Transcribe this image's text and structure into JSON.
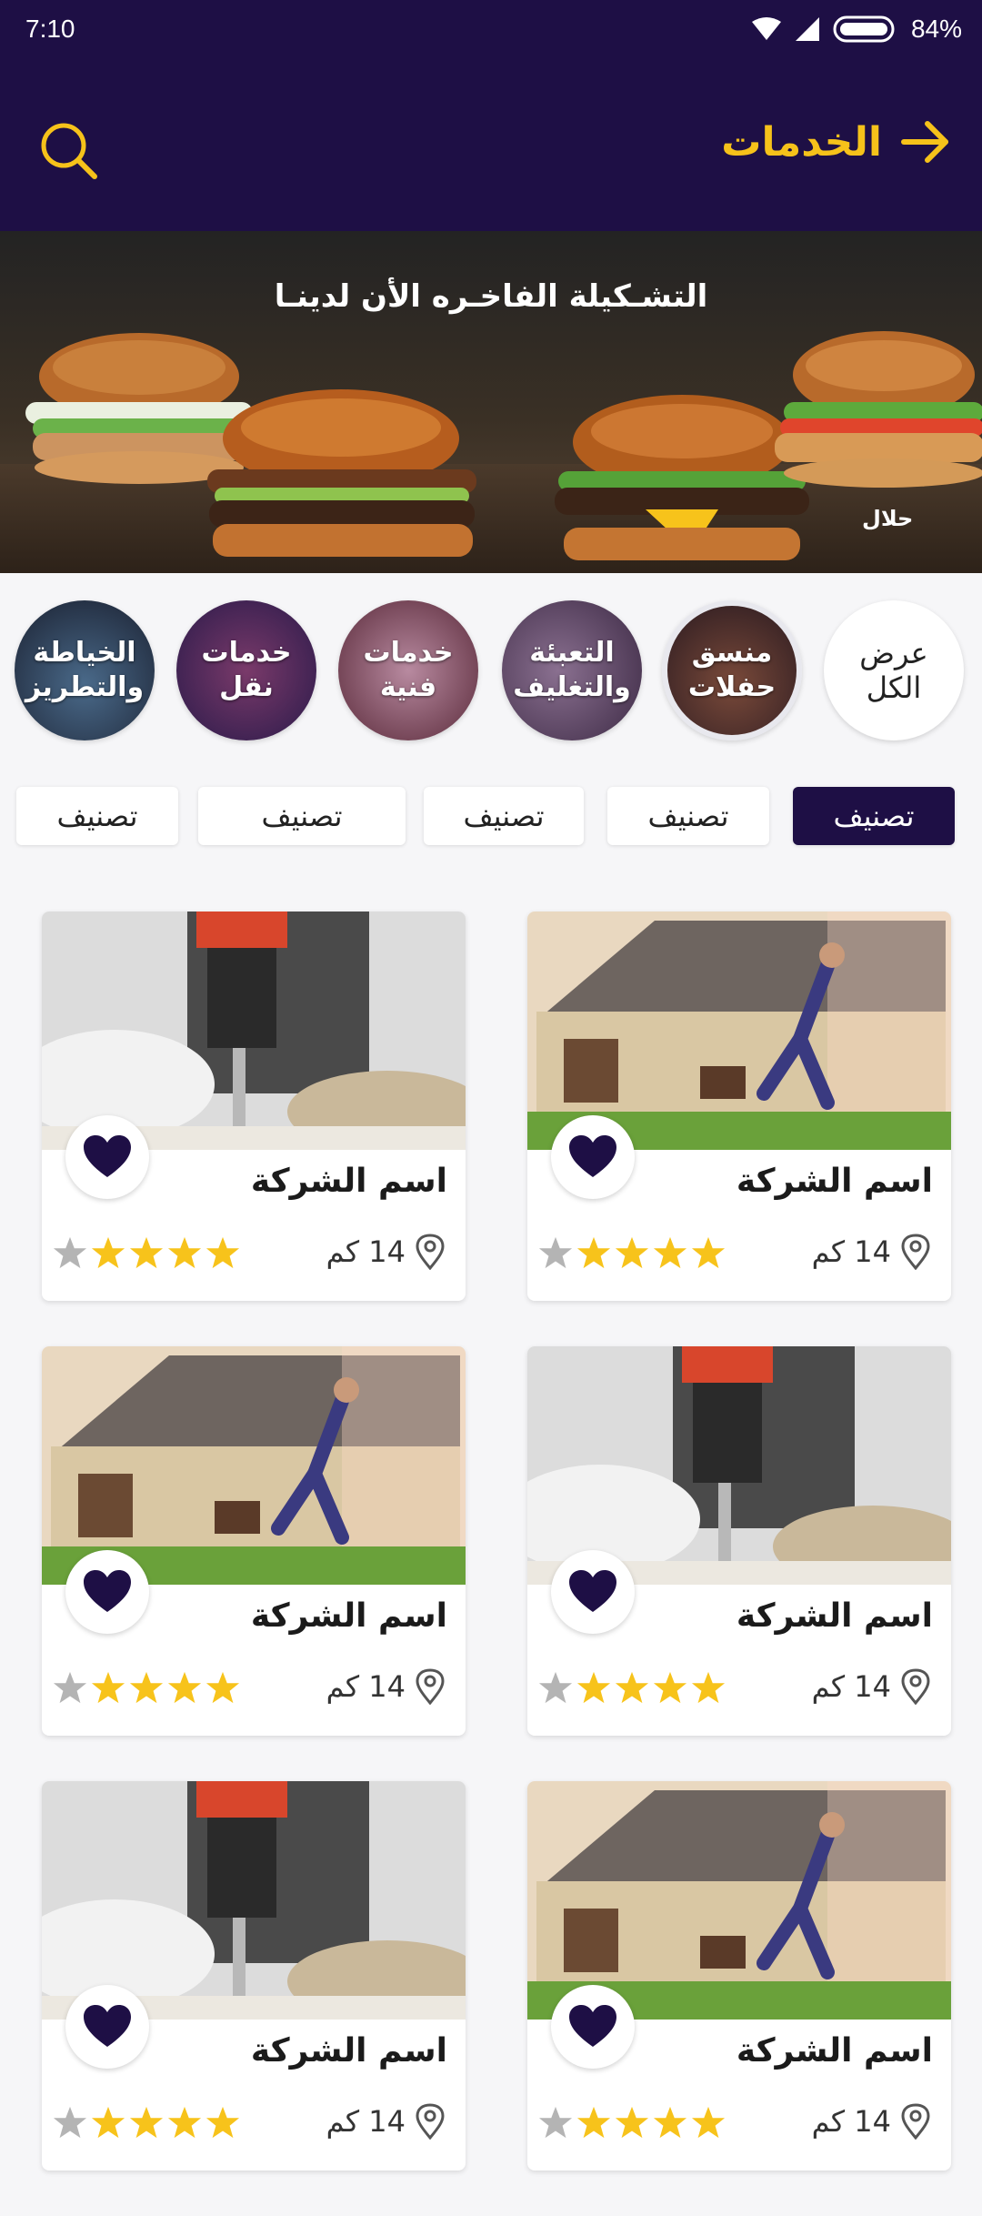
{
  "status_bar": {
    "time": "7:10",
    "battery": "84%"
  },
  "header": {
    "title": "الخدمات"
  },
  "banner": {
    "headline": "التشـكيلة الفاخـره الأن لدينـا",
    "badge": "حلال"
  },
  "categories": [
    {
      "label": "عرض الكل"
    },
    {
      "label": "منسق حفلات"
    },
    {
      "label": "التعبئة والتغليف"
    },
    {
      "label": "خدمات فنية"
    },
    {
      "label": "خدمات نقل"
    },
    {
      "label": "الخياطة والتطريز"
    }
  ],
  "filters": [
    {
      "label": "تصنيف",
      "active": true
    },
    {
      "label": "تصنيف",
      "active": false
    },
    {
      "label": "تصنيف",
      "active": false
    },
    {
      "label": "تصنيف",
      "active": false
    },
    {
      "label": "تصنيف",
      "active": false
    }
  ],
  "cards": [
    {
      "name": "اسم الشركة",
      "distance": "14 كم",
      "rating": 4,
      "image": "house-jump"
    },
    {
      "name": "اسم الشركة",
      "distance": "14 كم",
      "rating": 4,
      "image": "drill"
    },
    {
      "name": "اسم الشركة",
      "distance": "14 كم",
      "rating": 4,
      "image": "drill"
    },
    {
      "name": "اسم الشركة",
      "distance": "14 كم",
      "rating": 4,
      "image": "house-jump"
    },
    {
      "name": "اسم الشركة",
      "distance": "14 كم",
      "rating": 4,
      "image": "house-jump"
    },
    {
      "name": "اسم الشركة",
      "distance": "14 كم",
      "rating": 4,
      "image": "drill"
    }
  ],
  "colors": {
    "primary": "#1e0f45",
    "accent": "#f6c21a",
    "star": "#f7c31b",
    "star_empty": "#b4b4b4"
  }
}
